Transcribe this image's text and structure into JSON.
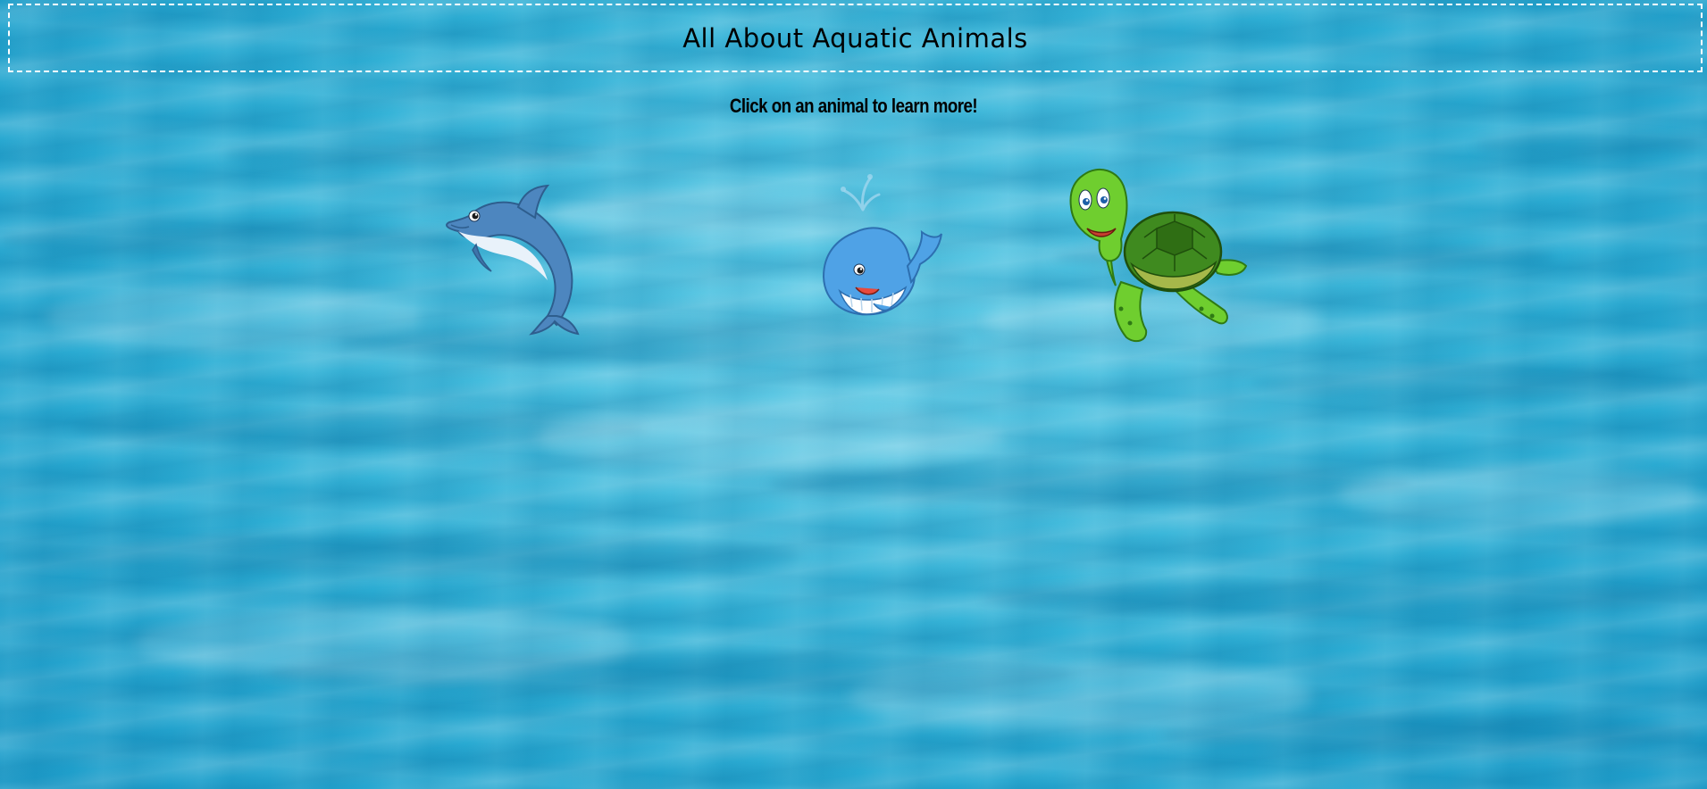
{
  "page": {
    "title": "All About Aquatic Animals",
    "subtitle": "Click on an animal to learn more!"
  },
  "animals": [
    {
      "name": "dolphin",
      "icon": "dolphin-icon"
    },
    {
      "name": "whale",
      "icon": "whale-icon"
    },
    {
      "name": "turtle",
      "icon": "turtle-icon"
    }
  ],
  "colors": {
    "water": "#2fb3d6",
    "title_border": "#ffffff",
    "text": "#000000"
  }
}
